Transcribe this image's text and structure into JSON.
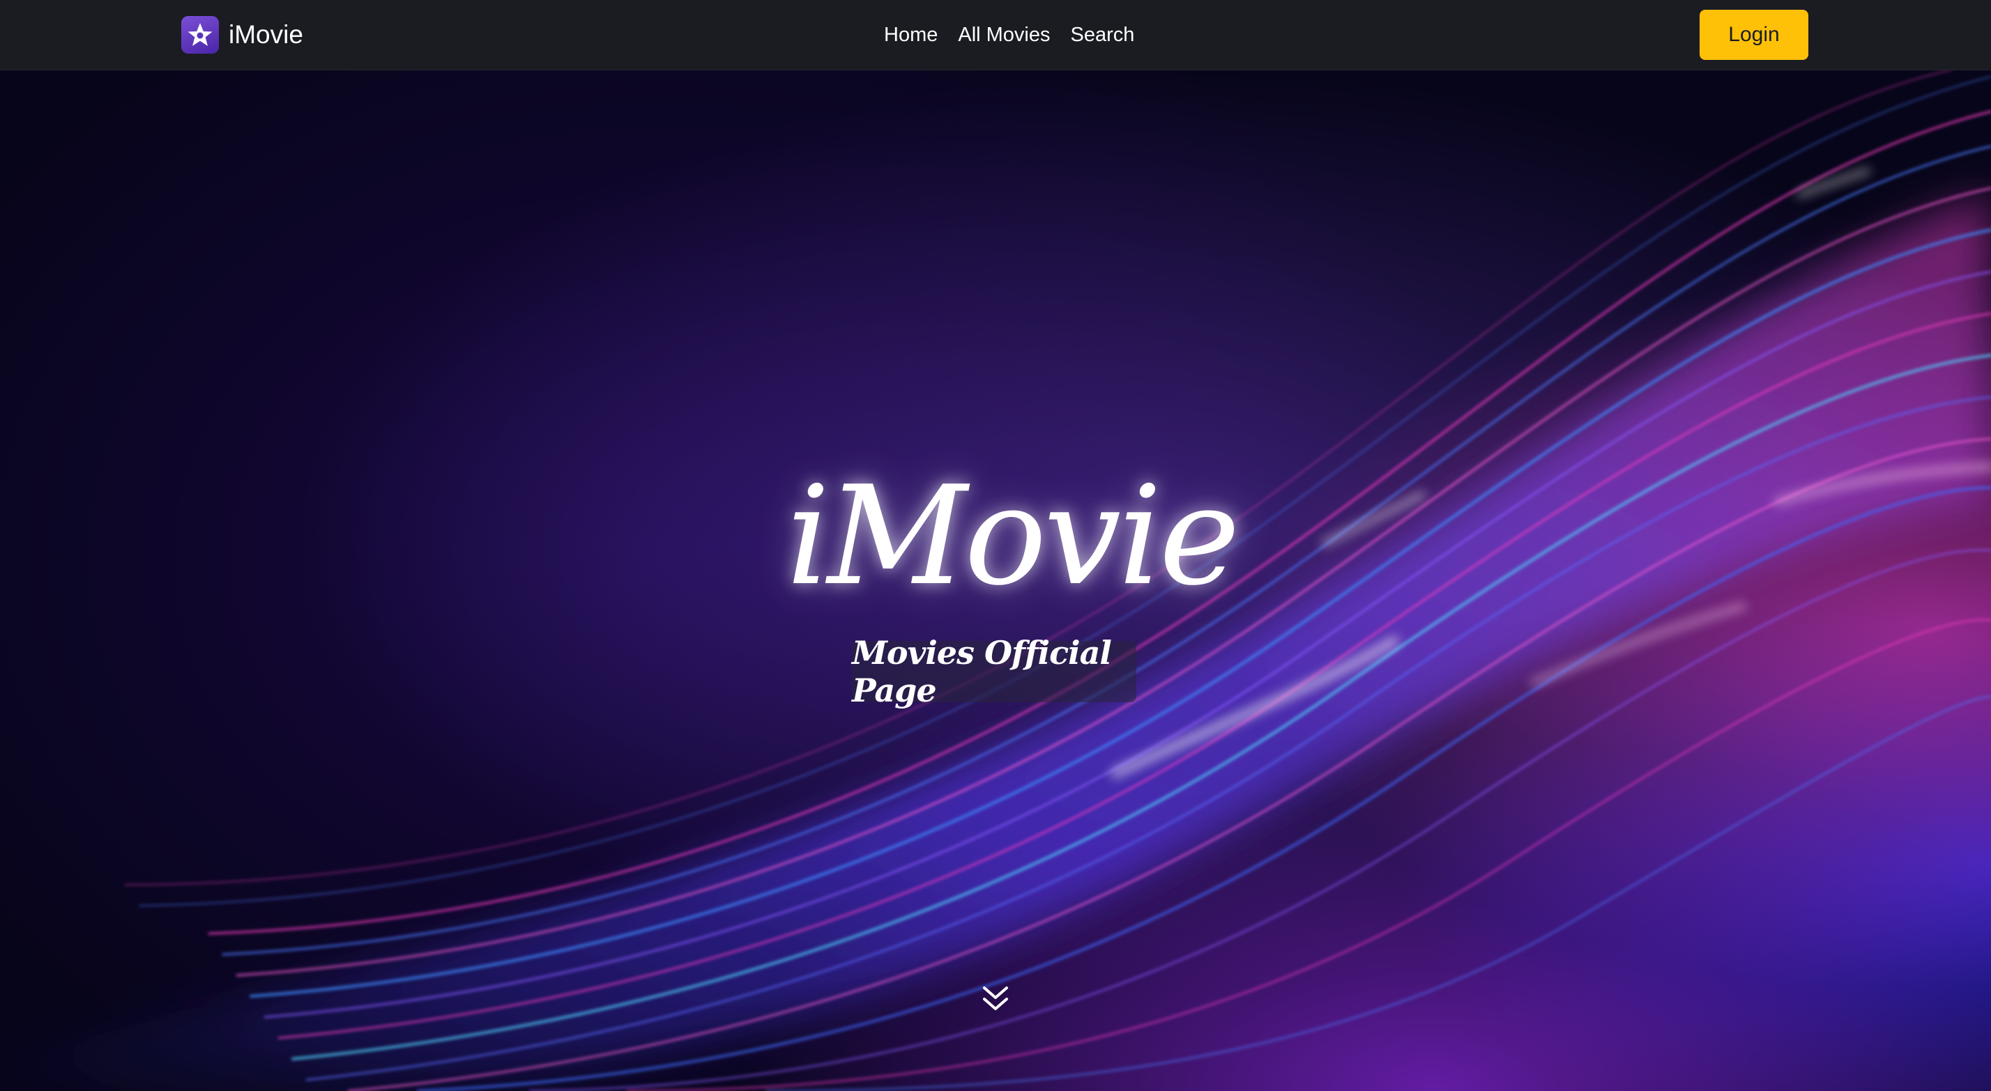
{
  "navbar": {
    "brand": {
      "name": "iMovie",
      "logo_icon": "star-icon"
    },
    "links": [
      {
        "label": "Home"
      },
      {
        "label": "All Movies"
      },
      {
        "label": "Search"
      }
    ],
    "login_label": "Login"
  },
  "hero": {
    "title": "iMovie",
    "subtitle": "Movies Official Page",
    "scroll_icon": "chevron-double-down-icon"
  },
  "colors": {
    "navbar_bg": "#1b1c22",
    "accent": "#ffc107",
    "hero_bg": "#0a0620",
    "logo_bg": "#5b33c0",
    "wave_pink": "#ff3fc8",
    "wave_blue": "#3a6bff",
    "wave_cyan": "#4fd2ff"
  }
}
